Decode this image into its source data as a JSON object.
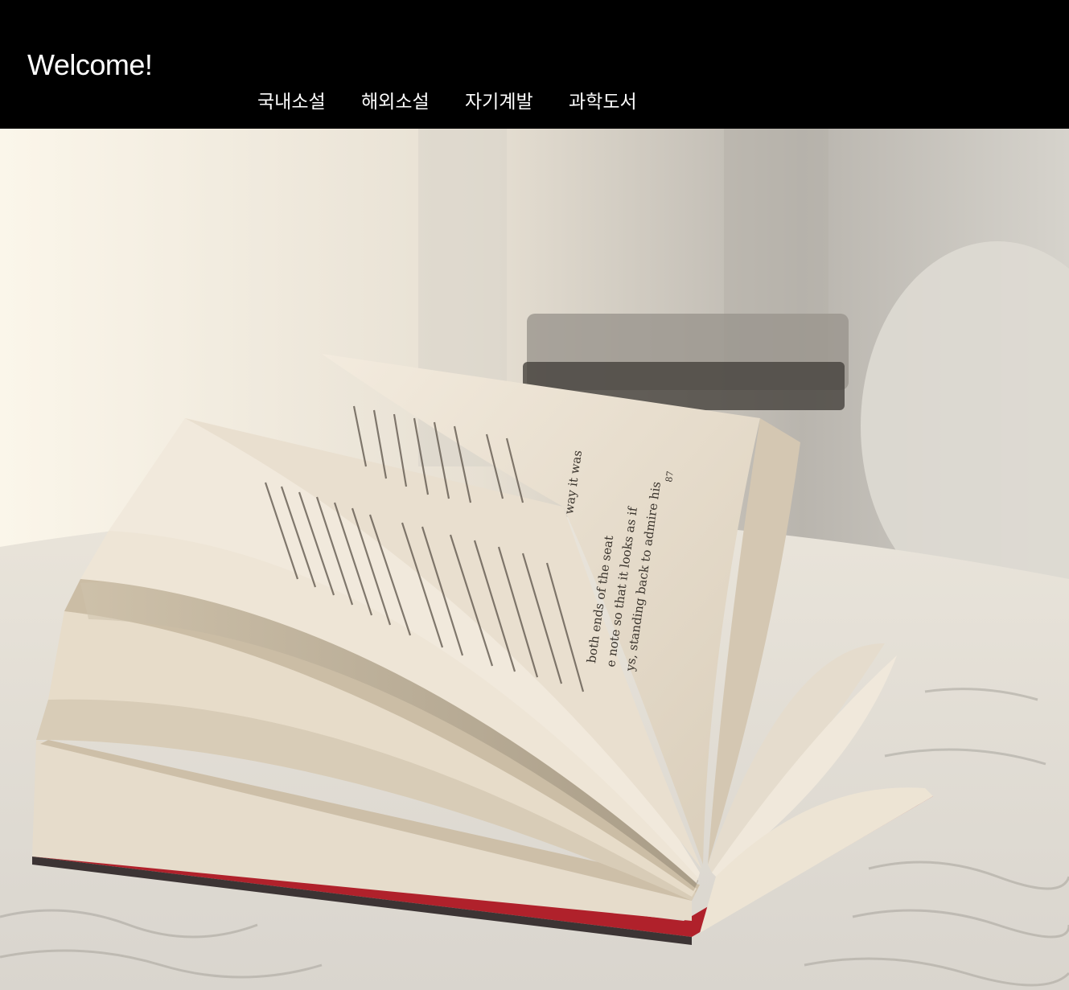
{
  "header": {
    "title": "Welcome!",
    "nav": [
      {
        "label": "국내소설"
      },
      {
        "label": "해외소설"
      },
      {
        "label": "자기계발"
      },
      {
        "label": "과학도서"
      }
    ]
  },
  "hero": {
    "image_icon": "open-book-photo",
    "page_text": [
      "both ends of the seat",
      "e note so that it looks as if",
      "ys, standing back to admire his",
      "way it was",
      "87"
    ]
  },
  "colors": {
    "header_bg": "#000000",
    "header_text": "#ffffff",
    "paper": "#efe6d6",
    "book_cover": "#b0212b"
  }
}
